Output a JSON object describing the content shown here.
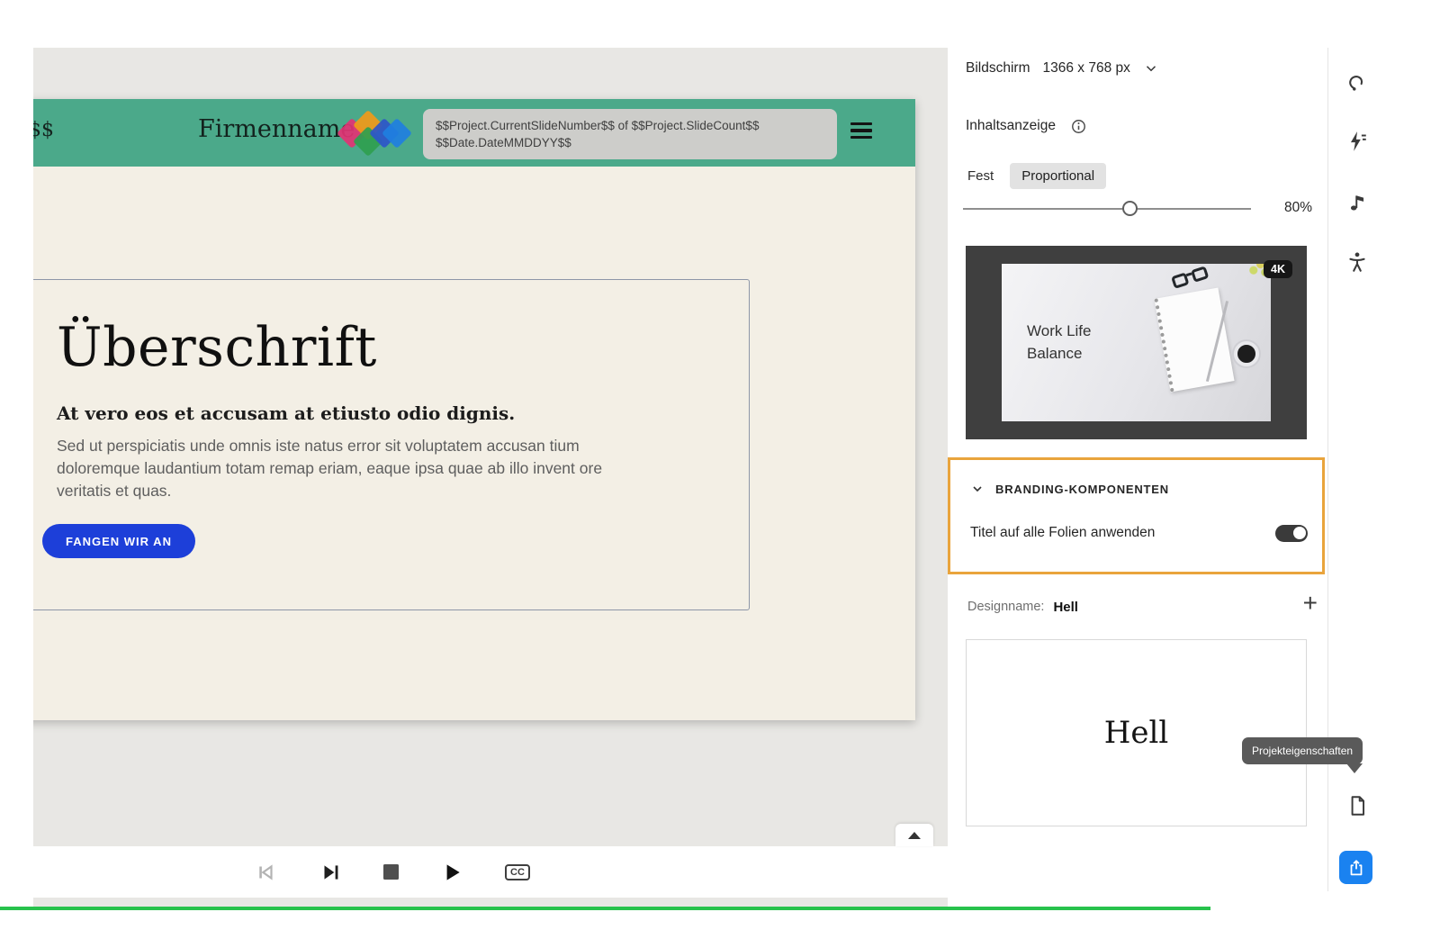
{
  "colors": {
    "slide_header_green": "#4ba98a",
    "cta_blue": "#1d3fd9",
    "highlight_orange": "#e9a43c",
    "share_blue": "#1a82f0",
    "bottom_line_green": "#27c24c"
  },
  "slide": {
    "header": {
      "left_placeholder": "$$",
      "company_name": "Firmenname",
      "counter_line1": "$$Project.CurrentSlideNumber$$ of $$Project.SlideCount$$",
      "counter_line2": "$$Date.DateMMDDYY$$"
    },
    "heading": "Überschrift",
    "subheading": "At vero eos et accusam at etiusto odio dignis.",
    "body_lines": [
      "Sed ut perspiciatis unde omnis iste natus error sit voluptatem accusan tium",
      "doloremque laudantium totam remap eriam, eaque ipsa quae ab illo invent ore",
      "veritatis et quas."
    ],
    "cta_label": "FANGEN WIR AN"
  },
  "player": {
    "cc_label": "CC"
  },
  "panel": {
    "screen": {
      "label": "Bildschirm",
      "value": "1366 x 768 px"
    },
    "content_display": {
      "label": "Inhaltsanzeige"
    },
    "fit_fixed": "Fest",
    "fit_proportional": "Proportional",
    "fit_selected": "Proportional",
    "zoom_value": "80%",
    "video": {
      "badge": "4K",
      "caption1": "Work Life",
      "caption2": "Balance"
    },
    "branding": {
      "title": "BRANDING-KOMPONENTEN",
      "toggle_label": "Titel auf alle Folien anwenden",
      "toggle_on": true
    },
    "design": {
      "label": "Designname:",
      "name": "Hell",
      "add": "+",
      "preview": "Hell"
    },
    "tooltip": "Projekteigenschaften"
  }
}
